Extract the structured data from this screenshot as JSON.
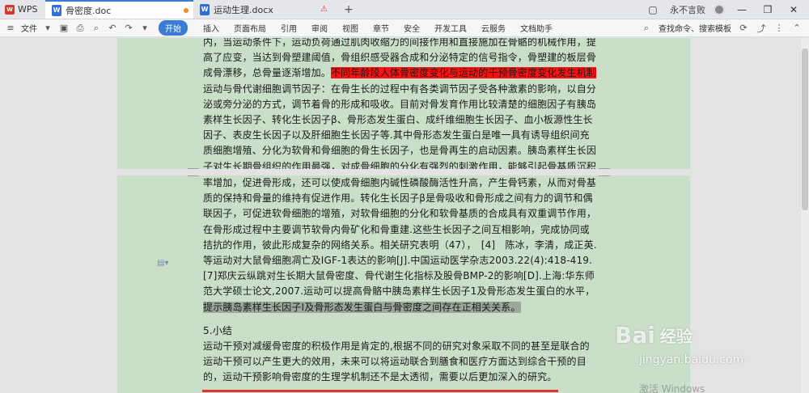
{
  "titlebar": {
    "app_label": "WPS",
    "tabs": [
      {
        "label": "骨密度.doc"
      },
      {
        "label": "运动生理.docx"
      }
    ],
    "user_label": "永不言败"
  },
  "menubar": {
    "file_label": "文件",
    "start_label": "开始",
    "items": [
      "插入",
      "页面布局",
      "引用",
      "审阅",
      "视图",
      "章节",
      "安全",
      "开发工具",
      "云服务",
      "文档助手"
    ],
    "search_label": "查找命令、搜索模板"
  },
  "document": {
    "page1_lines": [
      {
        "text": "内，当运动条件下，运动负荷通过肌肉收缩力的间接作用和直接施加在骨骼的机械作用，提",
        "hl": ""
      },
      {
        "text": "高了应变，当达到骨塑建阈值，骨组织感受器合成和分泌特定的信号指令，骨塑建的板层骨",
        "hl": ""
      },
      {
        "text": "成骨漂移，总骨量逐渐增加。",
        "hl": "",
        "tail": "不同年龄段人体骨密度变化与运动的干预骨密度变化发生机制"
      },
      {
        "text": "运动与骨代谢细胞调节因子：在骨生长的过程中有各类调节因子受各种激素的影响，以自分",
        "hl": ""
      },
      {
        "text": "泌或旁分泌的方式，调节着骨的形成和吸收。目前对骨发育作用比较清楚的细胞因子有胰岛",
        "hl": ""
      },
      {
        "text": "素样生长因子、转化生长因子β、骨形态发生蛋白、成纤维细胞生长因子、血小板源性生长",
        "hl": ""
      },
      {
        "text": "因子、表皮生长因子以及肝细胞生长因子等.其中骨形态发生蛋白是唯一具有诱导组织间充",
        "hl": ""
      },
      {
        "text": "质细胞增殖、分化为软骨和骨细胞的骨生长因子，也是骨再生的启动因素。胰岛素样生长因",
        "hl": ""
      },
      {
        "text": "子对生长期骨组织的作用最强，对成骨细胞的分化有强烈的刺激作用，能够引起骨基质沉积",
        "hl": ""
      }
    ],
    "page2_lines": [
      {
        "text": "率增加，促进骨形成，还可以使成骨细胞内碱性磷酸酶活性升高，产生骨钙素，从而对骨基",
        "hl": ""
      },
      {
        "text": "质的保持和骨量的维持有促进作用。转化生长因子β是骨吸收和骨形成之间有力的调节和偶",
        "hl": ""
      },
      {
        "text": "联因子，可促进软骨细胞的增殖，对软骨细胞的分化和软骨基质的合成具有双重调节作用，",
        "hl": ""
      },
      {
        "text": "在骨形成过程中主要调节软骨内骨矿化和骨重建.这些生长因子之间互相影响，完成协同或",
        "hl": ""
      },
      {
        "text": "拮抗的作用，彼此形成复杂的网络关系。相关研究表明（47），　[4]　陈冰，李清，成正英.",
        "hl": ""
      },
      {
        "text": "等运动对大鼠骨细胞凋亡及IGF-1表达的影响[J].中国运动医学杂志2003.22(4):418-419.",
        "hl": ""
      },
      {
        "text": "[7]郑庆云纵跳对生长期大鼠骨密度、骨代谢生化指标及股骨BMP-2的影响[D].上海:华东师",
        "hl": ""
      },
      {
        "text": "范大学硕士论文,2007.运动可以提高骨骼中胰岛素样生长因子1及骨形态发生蛋白的水平，",
        "hl": ""
      },
      {
        "text": "提示胰岛素样生长因子Ⅰ及骨形态发生蛋白与骨密度之间存在正相关关系。",
        "hl": "grey"
      }
    ],
    "section_heading": "5.小结",
    "summary_lines": [
      {
        "text": "运动干预对减缓骨密度的积极作用是肯定的,根据不同的研究对象采取不同的甚至是联合的",
        "hl": ""
      },
      {
        "text": "运动干预可以产生更大的效用，未来可以将运动联合到膳食和医疗方面达到综合干预的目",
        "hl": ""
      },
      {
        "text": "的，运动干预影响骨密度的生理学机制还不是太透彻，需要以后更加深入的研究。",
        "hl": ""
      }
    ]
  },
  "watermark": {
    "logo": "Bai",
    "logo_suffix": "经验",
    "url": "jingyan.baidu.com",
    "activate": "激活 Windows"
  }
}
